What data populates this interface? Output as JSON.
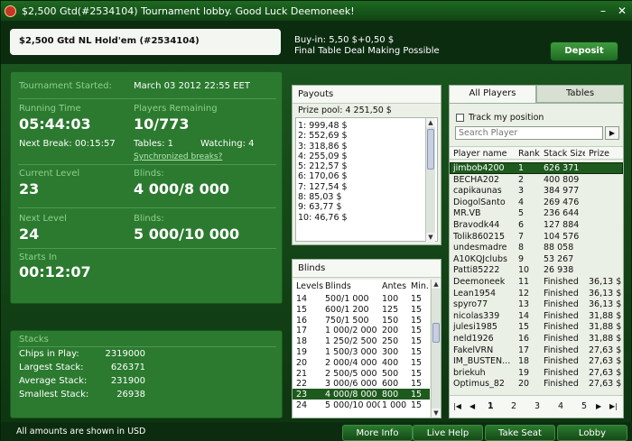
{
  "window": {
    "title": "$2,500 Gtd(#2534104) Tournament lobby. Good Luck Deemoneek!",
    "min": "–",
    "close": "✕"
  },
  "tournament_name": "$2,500 Gtd NL Hold'em (#2534104)",
  "buyin": {
    "line1": "Buy-in: 5,50 $+0,50 $",
    "line2": "Final Table Deal Making Possible"
  },
  "deposit_label": "Deposit",
  "info": {
    "started_label": "Tournament Started:",
    "started_value": "March 03 2012  22:55 EET",
    "running_label": "Running Time",
    "running_value": "05:44:03",
    "players_label": "Players Remaining",
    "players_value": "10/773",
    "next_break": "Next Break: 00:15:57",
    "tables": "Tables: 1",
    "watching": "Watching: 4",
    "sync_link": "Synchronized breaks?",
    "current_level_label": "Current Level",
    "current_level_value": "23",
    "blinds_label": "Blinds:",
    "current_blinds": "4 000/8 000",
    "next_level_label": "Next Level",
    "next_level_value": "24",
    "next_blinds": "5 000/10 000",
    "starts_label": "Starts In",
    "starts_value": "00:12:07"
  },
  "stacks": {
    "title": "Stacks",
    "rows": [
      {
        "label": "Chips in Play:",
        "value": "2319000"
      },
      {
        "label": "Largest Stack:",
        "value": "626371"
      },
      {
        "label": "Average Stack:",
        "value": "231900"
      },
      {
        "label": "Smallest Stack:",
        "value": "26938"
      }
    ]
  },
  "payouts": {
    "title": "Payouts",
    "prize_pool": "Prize pool: 4 251,50 $",
    "items": [
      "1: 999,48 $",
      "2: 552,69 $",
      "3: 318,86 $",
      "4: 255,09 $",
      "5: 212,57 $",
      "6: 170,06 $",
      "7: 127,54 $",
      "8: 85,03 $",
      "9: 63,77 $",
      "10: 46,76 $"
    ]
  },
  "blinds": {
    "title": "Blinds",
    "headers": [
      "Levels",
      "Blinds",
      "Antes",
      "Min."
    ],
    "rows": [
      [
        "14",
        "500/1 000",
        "100",
        "15"
      ],
      [
        "15",
        "600/1 200",
        "125",
        "15"
      ],
      [
        "16",
        "750/1 500",
        "150",
        "15"
      ],
      [
        "17",
        "1 000/2 000",
        "200",
        "15"
      ],
      [
        "18",
        "1 250/2 500",
        "250",
        "15"
      ],
      [
        "19",
        "1 500/3 000",
        "300",
        "15"
      ],
      [
        "20",
        "2 000/4 000",
        "400",
        "15"
      ],
      [
        "21",
        "2 500/5 000",
        "500",
        "15"
      ],
      [
        "22",
        "3 000/6 000",
        "600",
        "15"
      ],
      [
        "23",
        "4 000/8 000",
        "800",
        "15"
      ],
      [
        "24",
        "5 000/10 000",
        "1 000",
        "15"
      ]
    ],
    "highlight_index": 9
  },
  "players": {
    "tab_all": "All Players",
    "tab_tables": "Tables",
    "track_label": "Track my position",
    "search_placeholder": "Search Player",
    "headers": [
      "Player name",
      "Rank",
      "Stack Size",
      "Prize"
    ],
    "rows": [
      [
        "jimbob4200",
        "1",
        "626 371",
        ""
      ],
      [
        "BECHA202",
        "2",
        "400 809",
        ""
      ],
      [
        "capikaunas",
        "3",
        "384 977",
        ""
      ],
      [
        "DiogolSanto",
        "4",
        "269 476",
        ""
      ],
      [
        "MR.VB",
        "5",
        "236 644",
        ""
      ],
      [
        "Bravodk44",
        "6",
        "127 884",
        ""
      ],
      [
        "Tolik860215",
        "7",
        "104 576",
        ""
      ],
      [
        "undesmadre",
        "8",
        "88 058",
        ""
      ],
      [
        "A10KQJclubs",
        "9",
        "53 267",
        ""
      ],
      [
        "Patti85222",
        "10",
        "26 938",
        ""
      ],
      [
        "Deemoneek",
        "11",
        "Finished",
        "36,13 $"
      ],
      [
        "Lean1954",
        "12",
        "Finished",
        "36,13 $"
      ],
      [
        "spyro77",
        "13",
        "Finished",
        "36,13 $"
      ],
      [
        "nicolas339",
        "14",
        "Finished",
        "31,88 $"
      ],
      [
        "julesi1985",
        "15",
        "Finished",
        "31,88 $"
      ],
      [
        "neld1926",
        "16",
        "Finished",
        "31,88 $"
      ],
      [
        "FakelVRN",
        "17",
        "Finished",
        "27,63 $"
      ],
      [
        "IM_BUSTEN...",
        "18",
        "Finished",
        "27,63 $"
      ],
      [
        "briekuh",
        "19",
        "Finished",
        "27,63 $"
      ],
      [
        "Optimus_82",
        "20",
        "Finished",
        "27,63 $"
      ]
    ],
    "selected_index": 0,
    "pages": [
      "1",
      "2",
      "3",
      "4",
      "5"
    ],
    "current_page": "1"
  },
  "footer": {
    "note": "All amounts are shown in USD",
    "buttons": [
      "More Info",
      "Live Help",
      "Take Seat",
      "Lobby"
    ]
  }
}
